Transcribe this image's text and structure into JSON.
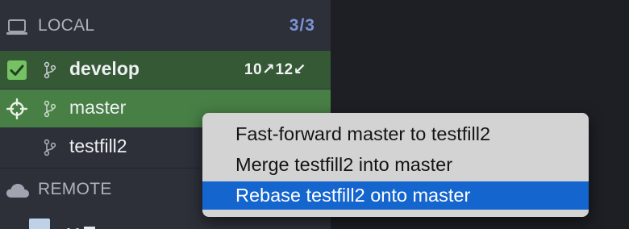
{
  "sidebar": {
    "local_section": {
      "label": "LOCAL",
      "count": "3/3",
      "icon": "laptop-icon"
    },
    "branches": [
      {
        "name": "develop",
        "state": "checked-out",
        "tracking": "10↗12↙",
        "state_icon": "checkbox-checked-icon"
      },
      {
        "name": "master",
        "state": "selected",
        "tracking": "",
        "state_icon": "crosshair-icon"
      },
      {
        "name": "testfill2",
        "state": "normal",
        "tracking": "",
        "state_icon": ""
      }
    ],
    "remote_section": {
      "label": "REMOTE",
      "icon": "cloud-icon"
    }
  },
  "context_menu": {
    "items": [
      {
        "label": "Fast-forward master to testfill2",
        "highlighted": false
      },
      {
        "label": "Merge testfill2 into master",
        "highlighted": false
      },
      {
        "label": "Rebase testfill2 onto master",
        "highlighted": true
      }
    ]
  },
  "colors": {
    "sidebar_bg": "#2d3039",
    "checked_out_row": "#355935",
    "selected_row": "#477f45",
    "count_accent": "#7e93d9",
    "menu_highlight": "#1565cf"
  }
}
